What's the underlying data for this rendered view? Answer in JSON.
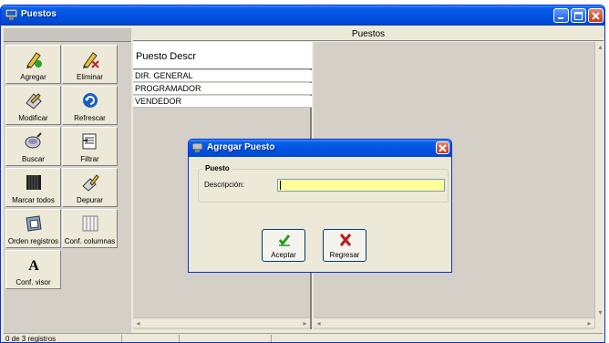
{
  "window": {
    "title": "Puestos",
    "grid_header": "Puestos",
    "status": "0 de 3 registros"
  },
  "toolbar": {
    "items": [
      {
        "label": "Agregar",
        "icon": "add-pencil-icon"
      },
      {
        "label": "Eliminar",
        "icon": "delete-pencil-icon"
      },
      {
        "label": "Modificar",
        "icon": "edit-icon"
      },
      {
        "label": "Refrescar",
        "icon": "refresh-icon"
      },
      {
        "label": "Buscar",
        "icon": "search-icon"
      },
      {
        "label": "Filtrar",
        "icon": "filter-icon"
      },
      {
        "label": "Marcar todos",
        "icon": "select-all-icon"
      },
      {
        "label": "Depurar",
        "icon": "purge-icon"
      },
      {
        "label": "Orden registros",
        "icon": "sort-icon"
      },
      {
        "label": "Conf. columnas",
        "icon": "columns-icon"
      },
      {
        "label": "Conf. visor",
        "icon": "font-icon"
      }
    ]
  },
  "table": {
    "columns": [
      "Puesto Descr"
    ],
    "rows": [
      "DIR. GENERAL",
      "PROGRAMADOR",
      "VENDEDOR"
    ]
  },
  "dialog": {
    "title": "Agregar Puesto",
    "group_label": "Puesto",
    "field_label": "Descripción:",
    "field_value": "",
    "accept_label": "Aceptar",
    "cancel_label": "Regresar"
  },
  "colors": {
    "titlebar": "#0054e3",
    "input_bg": "#ffff99",
    "panel_bg": "#ece9d8"
  }
}
